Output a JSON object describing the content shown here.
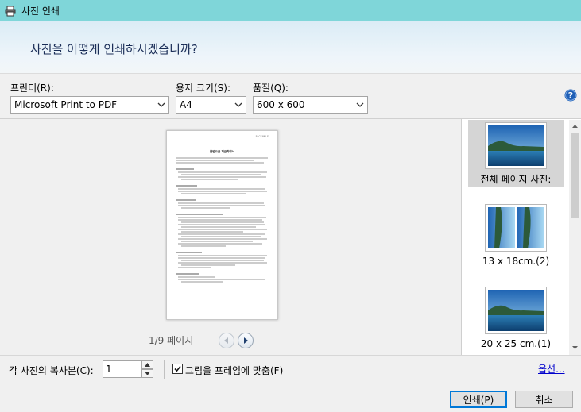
{
  "window": {
    "title": "사진 인쇄",
    "icon": "printer-icon"
  },
  "header": {
    "question": "사진을 어떻게 인쇄하시겠습니까?"
  },
  "printer": {
    "label": "프린터(R):",
    "value": "Microsoft Print to PDF"
  },
  "paper_size": {
    "label": "용지 크기(S):",
    "value": "A4"
  },
  "quality": {
    "label": "품질(Q):",
    "value": "600 x 600"
  },
  "preview": {
    "page_indicator": "1/9 페이지",
    "doc": {
      "header_right": "FACSIMILE",
      "title": "불법요금 지급확약서"
    }
  },
  "layouts": [
    {
      "label": "전체 페이지 사진:",
      "selected": true
    },
    {
      "label": "13 x 18cm.(2)",
      "selected": false
    },
    {
      "label": "20 x 25 cm.(1)",
      "selected": false
    }
  ],
  "copies": {
    "label": "각 사진의 복사본(C):",
    "value": "1"
  },
  "fit_to_frame": {
    "label": "그림을 프레임에 맞춤(F)",
    "checked": true
  },
  "options_link": "옵션...",
  "buttons": {
    "print": "인쇄(P)",
    "cancel": "취소"
  },
  "colors": {
    "titlebar": "#7fd6d9",
    "header_text": "#1a2d57",
    "link": "#0000cc",
    "accent": "#0078d7"
  }
}
